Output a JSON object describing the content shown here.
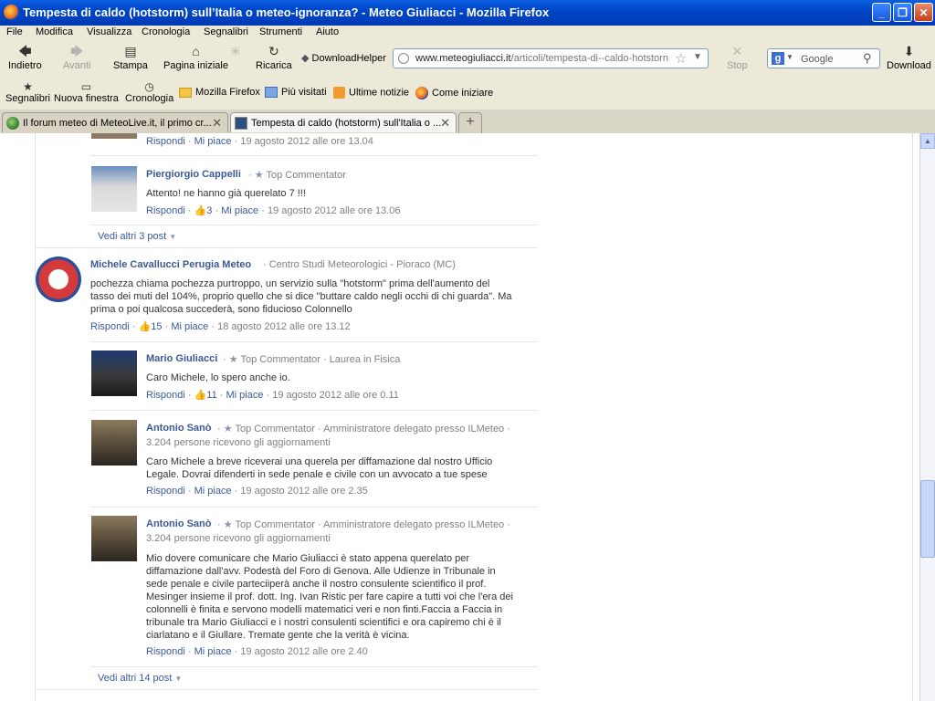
{
  "window": {
    "title": "Tempesta di caldo (hotstorm) sull’Italia o meteo-ignoranza? - Meteo Giuliacci - Mozilla Firefox",
    "min": "_",
    "max": "❐",
    "close": "✕"
  },
  "menu": [
    "File",
    "Modifica",
    "Visualizza",
    "Cronologia",
    "Segnalibri",
    "Strumenti",
    "Aiuto"
  ],
  "nav": {
    "back": "Indietro",
    "forward": "Avanti",
    "print": "Stampa",
    "home": "Pagina iniziale",
    "reload": "Ricarica",
    "downloadhelper": "DownloadHelper",
    "stop": "Stop",
    "download": "Download"
  },
  "urlbar": {
    "domain": "www.meteogiuliacci.it",
    "path": "/articoli/tempesta-di--caldo-hotstorn"
  },
  "search": {
    "engine": "Google"
  },
  "bookmarks": {
    "segnalibri": "Segnalibri",
    "nuova_finestra": "Nuova finestra",
    "cronologia": "Cronologia",
    "items": [
      "Mozilla Firefox",
      "Più visitati",
      "Ultime notizie",
      "Come iniziare"
    ]
  },
  "tabs": [
    {
      "title": "Il forum meteo di MeteoLive.it, il primo cr...",
      "close": "✕"
    },
    {
      "title": "Tempesta di caldo (hotstorm) sull'Italia o ...",
      "close": "✕"
    }
  ],
  "newtab": "+",
  "comments": {
    "top_actions": {
      "reply": "Rispondi",
      "like": "Mi piace",
      "date": "19 agosto 2012 alle ore 13.04"
    },
    "c1": {
      "name": "Piergiorgio Cappelli",
      "badge": "Top Commentator",
      "text": "Attento! ne hanno già querelato 7 !!!",
      "reply": "Rispondi",
      "likes": "3",
      "like": "Mi piace",
      "date": "19 agosto 2012 alle ore 13.06"
    },
    "more1": "Vedi altri 3 post",
    "c2": {
      "name": "Michele Cavallucci Perugia Meteo",
      "affiliation": "Centro Studi Meteorologici - Pioraco (MC)",
      "text": "pochezza chiama pochezza purtroppo, un servizio sulla \"hotstorm\" prima dell'aumento del tasso dei muti del 104%, proprio quello che si dice \"buttare caldo negli occhi di chi guarda\". Ma prima o poi qualcosa succederà, sono fiducioso Colonnello",
      "reply": "Rispondi",
      "likes": "15",
      "like": "Mi piace",
      "date": "18 agosto 2012 alle ore 13.12"
    },
    "c3": {
      "name": "Mario Giuliacci",
      "badge": "Top Commentator",
      "extra": "Laurea in Fisica",
      "text": "Caro Michele, lo spero anche io.",
      "reply": "Rispondi",
      "likes": "11",
      "like": "Mi piace",
      "date": "19 agosto 2012 alle ore 0.11"
    },
    "c4": {
      "name": "Antonio Sanò",
      "badge": "Top Commentator",
      "extra": "Amministratore delegato presso ILMeteo",
      "followers": "3.204 persone ricevono gli aggiornamenti",
      "text": "Caro Michele a breve riceverai una querela per diffamazione dal nostro Ufficio Legale. Dovrai difenderti in sede penale e civile con un avvocato a tue spese",
      "reply": "Rispondi",
      "like": "Mi piace",
      "date": "19 agosto 2012 alle ore 2.35"
    },
    "c5": {
      "name": "Antonio Sanò",
      "badge": "Top Commentator",
      "extra": "Amministratore delegato presso ILMeteo",
      "followers": "3.204 persone ricevono gli aggiornamenti",
      "text": "Mio dovere comunicare che Mario Giuliacci è stato appena querelato per diffamazione dall'avv. Podestà del Foro di Genova. Alle Udienze in Tribunale in sede penale e civile parteciiperà anche il nostro consulente scientifico il prof. Mesinger insieme il prof. dott. Ing. Ivan Ristic per fare capire a tutti voi che l'era dei colonnelli è finita e servono modelli matematici veri e non finti.Faccia a Faccia in tribunale tra Mario Giuliacci e i nostri consulenti scientifici e ora capiremo chi è il ciarlatano e il Giullare. Tremate gente che la verità è vicina.",
      "reply": "Rispondi",
      "like": "Mi piace",
      "date": "19 agosto 2012 alle ore 2.40"
    },
    "more2": "Vedi altri 14 post"
  },
  "colors": {
    "link": "#3b5998",
    "meta": "#808080",
    "titlebar": "#0a5fe0"
  }
}
